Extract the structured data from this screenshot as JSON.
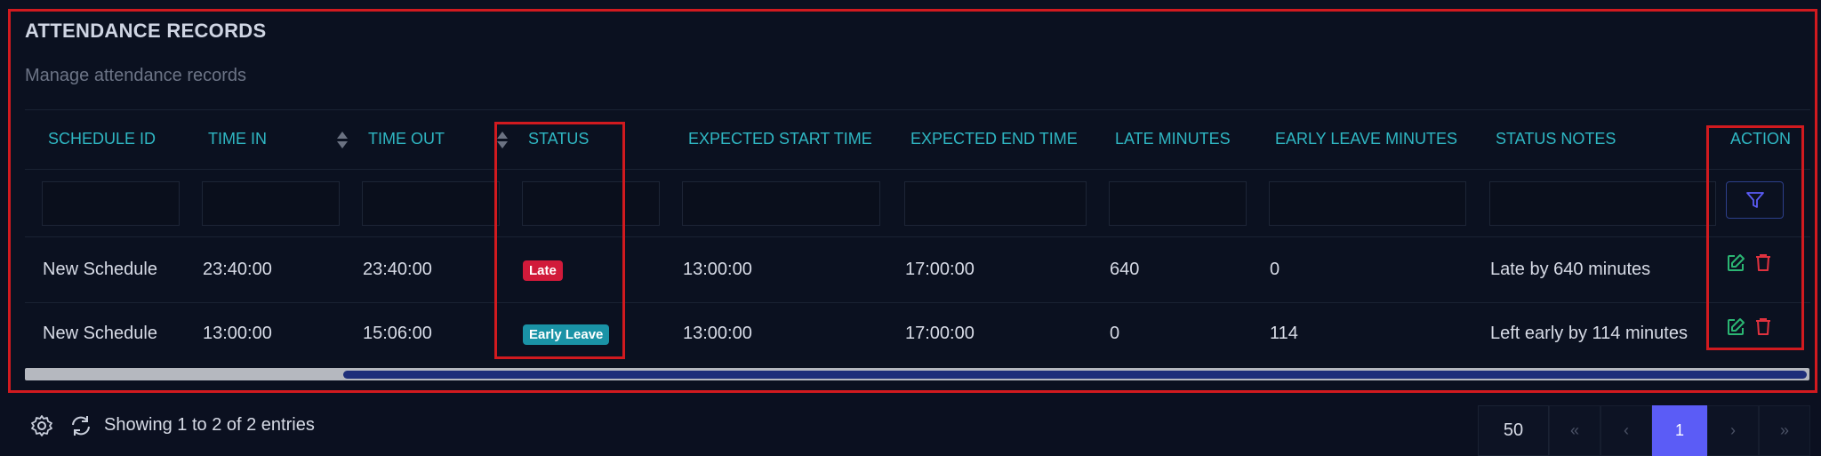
{
  "header": {
    "title": "ATTENDANCE RECORDS",
    "subtitle": "Manage attendance records"
  },
  "table": {
    "columns": [
      "SCHEDULE ID",
      "TIME IN",
      "TIME OUT",
      "STATUS",
      "EXPECTED START TIME",
      "EXPECTED END TIME",
      "LATE MINUTES",
      "EARLY LEAVE MINUTES",
      "STATUS NOTES",
      "ACTION"
    ],
    "rows": [
      {
        "schedule": "New Schedule",
        "time_in": "23:40:00",
        "time_out": "23:40:00",
        "status": "Late",
        "expected_start": "13:00:00",
        "expected_end": "17:00:00",
        "late_minutes": "640",
        "early_leave_minutes": "0",
        "notes": "Late by 640 minutes"
      },
      {
        "schedule": "New Schedule",
        "time_in": "13:00:00",
        "time_out": "15:06:00",
        "status": "Early Leave",
        "expected_start": "13:00:00",
        "expected_end": "17:00:00",
        "late_minutes": "0",
        "early_leave_minutes": "114",
        "notes": "Left early by 114 minutes"
      }
    ]
  },
  "footer": {
    "entries_text": "Showing 1 to 2 of 2 entries",
    "page_size": "50",
    "pagination": {
      "first": "«",
      "prev": "‹",
      "current": "1",
      "next": "›",
      "last": "»"
    }
  },
  "colors": {
    "accent": "#5b5cf6",
    "header_text": "#2fb7c3",
    "late_badge": "#d11a3a",
    "early_badge": "#1a93a6",
    "edit_icon": "#2bb673",
    "delete_icon": "#e0323f",
    "highlight_border": "#d11a1f"
  },
  "icons": [
    "filter-icon",
    "edit-icon",
    "trash-icon",
    "gear-icon",
    "refresh-icon",
    "sort-icon"
  ]
}
